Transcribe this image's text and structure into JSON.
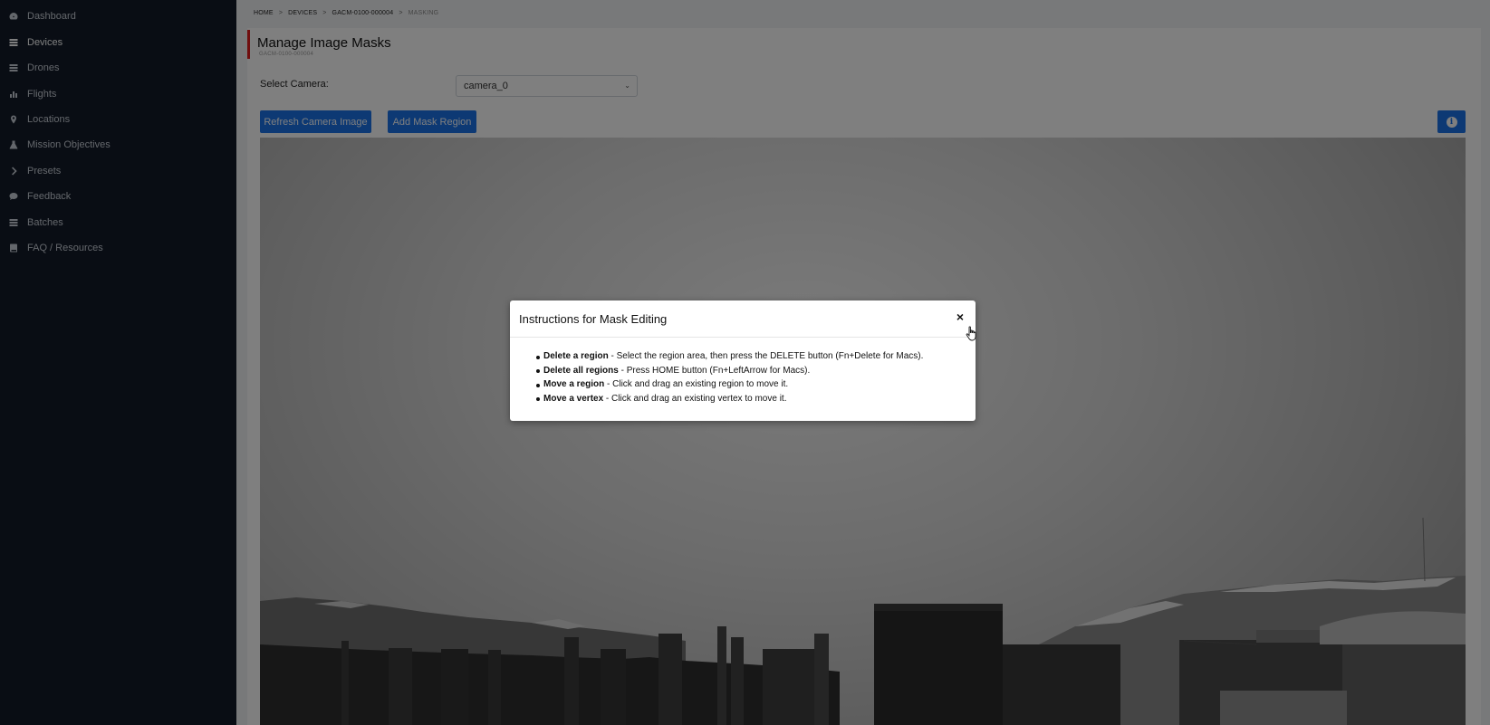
{
  "sidebar": {
    "items": [
      {
        "label": "Dashboard",
        "icon": "dashboard-icon"
      },
      {
        "label": "Devices",
        "icon": "list-icon",
        "active": true
      },
      {
        "label": "Drones",
        "icon": "list-icon"
      },
      {
        "label": "Flights",
        "icon": "chart-icon"
      },
      {
        "label": "Locations",
        "icon": "map-pin-icon"
      },
      {
        "label": "Mission Objectives",
        "icon": "flask-icon"
      },
      {
        "label": "Presets",
        "icon": "chevron-right-icon"
      },
      {
        "label": "Feedback",
        "icon": "chat-icon"
      },
      {
        "label": "Batches",
        "icon": "list-icon"
      },
      {
        "label": "FAQ / Resources",
        "icon": "book-icon"
      }
    ]
  },
  "breadcrumb": {
    "items": [
      "HOME",
      "DEVICES",
      "GACM-0100-000004",
      "MASKING"
    ],
    "separator": ">"
  },
  "page": {
    "title": "Manage Image Masks",
    "subtitle": "GACM-0100-000004"
  },
  "camera": {
    "label": "Select Camera:",
    "selected": "camera_0"
  },
  "buttons": {
    "refresh": "Refresh Camera Image",
    "add_mask": "Add Mask Region",
    "info": "i"
  },
  "modal": {
    "title": "Instructions for Mask Editing",
    "close": "×",
    "instructions": [
      {
        "bold": "Delete a region",
        "text": " - Select the region area, then press the DELETE button (Fn+Delete for Macs)."
      },
      {
        "bold": "Delete all regions",
        "text": " - Press HOME button (Fn+LeftArrow for Macs)."
      },
      {
        "bold": "Move a region",
        "text": " - Click and drag an existing region to move it."
      },
      {
        "bold": "Move a vertex",
        "text": " - Click and drag an existing vertex to move it."
      }
    ]
  },
  "colors": {
    "sidebar_bg": "#121b28",
    "accent_blue": "#1a73e8",
    "title_accent_red": "#e01d1d"
  }
}
